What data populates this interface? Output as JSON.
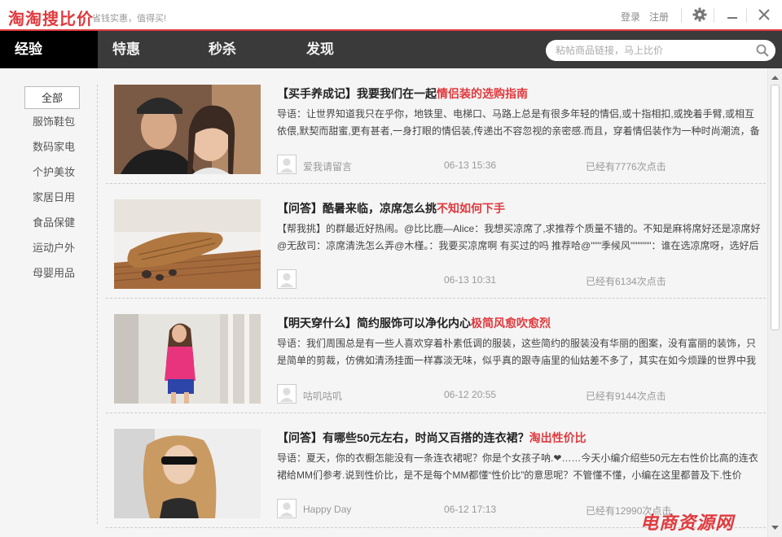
{
  "app": {
    "logo": "淘淘搜比价",
    "slogan": "省钱实惠，值得买!",
    "login": "登录",
    "register": "注册"
  },
  "colors": {
    "accent": "#e03a3e",
    "nav_bg": "#3a3a3a",
    "nav_active_bg": "#000000"
  },
  "nav": {
    "tabs": [
      {
        "label": "经验"
      },
      {
        "label": "特惠"
      },
      {
        "label": "秒杀"
      },
      {
        "label": "发现"
      }
    ],
    "search_placeholder": "粘帖商品链接，马上比价"
  },
  "sidebar": {
    "items": [
      {
        "label": "全部"
      },
      {
        "label": "服饰鞋包"
      },
      {
        "label": "数码家电"
      },
      {
        "label": "个护美妆"
      },
      {
        "label": "家居日用"
      },
      {
        "label": "食品保健"
      },
      {
        "label": "运动户外"
      },
      {
        "label": "母婴用品"
      }
    ]
  },
  "articles": [
    {
      "title": "【买手养成记】我要我们在一起",
      "highlight": "情侣装的选购指南",
      "summary": "导语：让世界知道我只在乎你，地铁里、电梯口、马路上总是有很多年轻的情侣,或十指相扣,或挽着手臂,或相互依偎,默契而甜蜜,更有甚者,一身打眼的情侣装,传递出不容忽视的亲密感.而且，穿着情侣装作为一种时尚潮流，备",
      "author": "爱我请留言",
      "date": "06-13 15:36",
      "views": "已经有7776次点击"
    },
    {
      "title": "【问答】酷暑来临，凉席怎么挑",
      "highlight": "不知如何下手",
      "summary": "【帮我挑】的群最近好热闹。@比比鹿—Alice：我想买凉席了,求推荐个质量不错的。不知是麻将席好还是凉席好@无敌司：凉席清洗怎么弄@木槿。：我要买凉席啊 有买过的吗 推荐哈@\"\"\"季候风\"\"\"\"\"\"：谁在选凉席呀，选好后",
      "author": "",
      "date": "06-13 10:31",
      "views": "已经有6134次点击"
    },
    {
      "title": "【明天穿什么】简约服饰可以净化内心",
      "highlight": "极简风愈吹愈烈",
      "summary": "导语：我们周围总是有一些人喜欢穿着朴素低调的服装，这些简约的服装没有华丽的图案，没有富丽的装饰，只是简单的剪裁，仿佛如清汤挂面一样寡淡无味，似乎真的跟寺庙里的仙姑差不多了，其实在如今烦躁的世界中我",
      "author": "咕叽咕叽",
      "date": "06-12 20:55",
      "views": "已经有9144次点击"
    },
    {
      "title": "【问答】有哪些50元左右，时尚又百搭的连衣裙？",
      "highlight": "淘出性价比",
      "summary": "导语：夏天，你的衣橱怎能没有一条连衣裙呢？你是个女孩子呐.❤……今天小编介绍些50元左右性价比高的连衣裙给MM们参考.说到性价比，是不是每个MM都懂“性价比”的意思呢？不管懂不懂，小编在这里都普及下.性价",
      "author": "Happy Day",
      "date": "06-12 17:13",
      "views": "已经有12990次点击"
    }
  ],
  "watermark": "电商资源网"
}
